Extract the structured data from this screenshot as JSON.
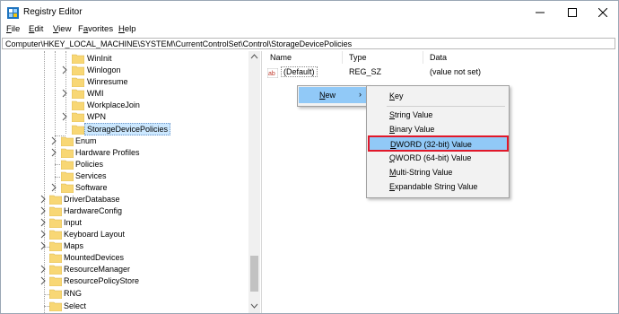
{
  "window": {
    "title": "Registry Editor",
    "minimize_label": "minimize",
    "maximize_label": "maximize",
    "close_label": "close"
  },
  "menu": {
    "file_u": "F",
    "file_rest": "ile",
    "edit_u": "E",
    "edit_rest": "dit",
    "view_u": "V",
    "view_rest": "iew",
    "fav_pre": "F",
    "fav_u": "a",
    "fav_rest": "vorites",
    "help_u": "H",
    "help_rest": "elp"
  },
  "address": "Computer\\HKEY_LOCAL_MACHINE\\SYSTEM\\CurrentControlSet\\Control\\StorageDevicePolicies",
  "tree": {
    "winlnit": "WinInit",
    "winlogon": "Winlogon",
    "winresume": "Winresume",
    "wmi": "WMI",
    "workplacejoin": "WorkplaceJoin",
    "wpn": "WPN",
    "storagedevicepolicies": "StorageDevicePolicies",
    "enum": "Enum",
    "hardware_profiles": "Hardware Profiles",
    "policies": "Policies",
    "services": "Services",
    "software": "Software",
    "driverdatabase": "DriverDatabase",
    "hardwareconfig": "HardwareConfig",
    "input": "Input",
    "keyboard_layout": "Keyboard Layout",
    "maps": "Maps",
    "mounteddevices": "MountedDevices",
    "resourcemanager": "ResourceManager",
    "resourcepolicystore": "ResourcePolicyStore",
    "rng": "RNG",
    "select": "Select"
  },
  "columns": {
    "name": "Name",
    "type": "Type",
    "data": "Data"
  },
  "value_row": {
    "name": "(Default)",
    "type": "REG_SZ",
    "data": "(value not set)"
  },
  "context_menu": {
    "new_u": "N",
    "new_rest": "ew",
    "submenu": {
      "key_u": "K",
      "key_rest": "ey",
      "string_u": "S",
      "string_rest": "tring Value",
      "binary_u": "B",
      "binary_rest": "inary Value",
      "dword_u": "D",
      "dword_rest": "WORD (32-bit) Value",
      "qword_u": "Q",
      "qword_rest": "WORD (64-bit) Value",
      "multi_u": "M",
      "multi_rest": "ulti-String Value",
      "expand_u": "E",
      "expand_rest": "xpandable String Value"
    }
  },
  "colors": {
    "highlight": "#91c9f7",
    "red_outline": "#e1182a",
    "folder": "#f8d775",
    "selection": "#cce8ff"
  }
}
